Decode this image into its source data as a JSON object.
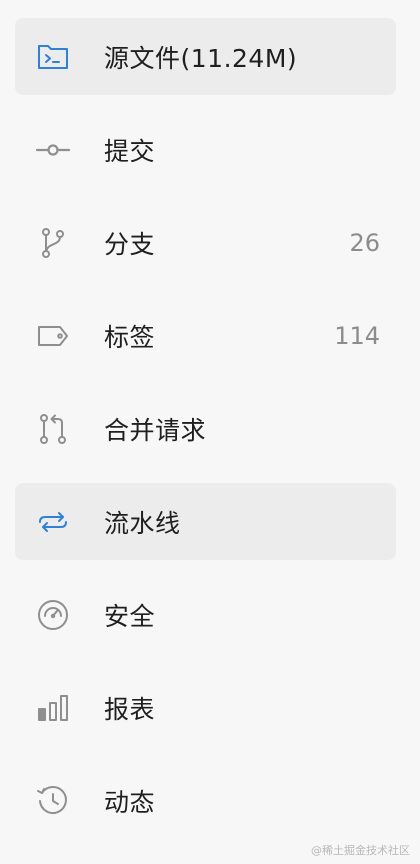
{
  "menu": {
    "items": [
      {
        "icon": "code-folder-icon",
        "label": "源文件(11.24M)",
        "active": true,
        "color": "#2f80d9"
      },
      {
        "icon": "commit-icon",
        "label": "提交",
        "active": false
      },
      {
        "icon": "branch-icon",
        "label": "分支",
        "count": "26",
        "active": false
      },
      {
        "icon": "tag-icon",
        "label": "标签",
        "count": "114",
        "active": false
      },
      {
        "icon": "pull-request-icon",
        "label": "合并请求",
        "active": false
      },
      {
        "icon": "pipeline-icon",
        "label": "流水线",
        "active": true,
        "color": "#2f80d9"
      },
      {
        "icon": "security-gauge-icon",
        "label": "安全",
        "active": false
      },
      {
        "icon": "report-bar-icon",
        "label": "报表",
        "active": false
      },
      {
        "icon": "history-icon",
        "label": "动态",
        "active": false
      }
    ]
  },
  "watermark": "@稀土掘金技术社区",
  "colors": {
    "active_bg": "#ececed",
    "icon_gray": "#8f8f8f",
    "accent_blue": "#2f80d9",
    "text": "#1f1f1f",
    "count_text": "#8c8c8c"
  }
}
